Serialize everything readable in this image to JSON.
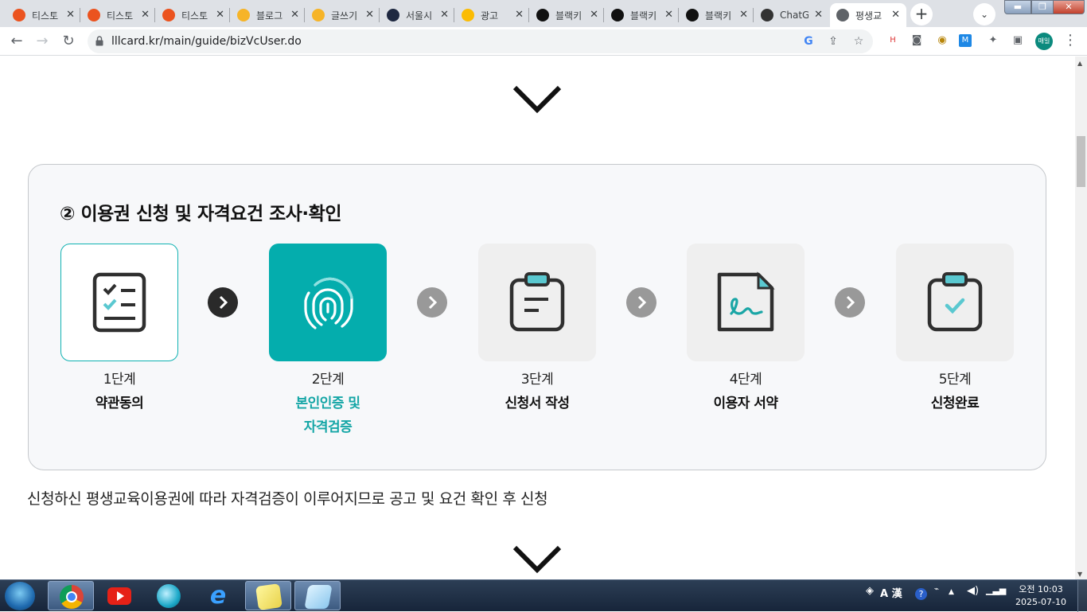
{
  "browser": {
    "tabs": [
      {
        "title": "티스토",
        "icon": "tistory-icon",
        "color": "#eb531f",
        "active": false
      },
      {
        "title": "티스토",
        "icon": "tistory-icon",
        "color": "#eb531f",
        "active": false
      },
      {
        "title": "티스토",
        "icon": "tistory-icon",
        "color": "#eb531f",
        "active": false
      },
      {
        "title": "블로그",
        "icon": "pm-icon",
        "color": "#f6b428",
        "active": false
      },
      {
        "title": "글쓰기",
        "icon": "pm-icon",
        "color": "#f6b428",
        "active": false
      },
      {
        "title": "서울시",
        "icon": "d-icon",
        "color": "#1e2840",
        "active": false
      },
      {
        "title": "광고",
        "icon": "google-ads-icon",
        "color": "#fbbc04",
        "active": false
      },
      {
        "title": "블랙키",
        "icon": "b-icon",
        "color": "#111111",
        "active": false
      },
      {
        "title": "블랙키",
        "icon": "b-icon",
        "color": "#111111",
        "active": false
      },
      {
        "title": "블랙키",
        "icon": "b-icon",
        "color": "#111111",
        "active": false
      },
      {
        "title": "ChatG",
        "icon": "openai-icon",
        "color": "#333333",
        "active": false
      },
      {
        "title": "평생교",
        "icon": "globe-icon",
        "color": "#5f6368",
        "active": true
      }
    ],
    "url": "lllcard.kr/main/guide/bizVcUser.do",
    "profile_label": "매일"
  },
  "page": {
    "section_title": "② 이용권 신청 및 자격요건 조사·확인",
    "steps": [
      {
        "num": "1단계",
        "label": "약관동의",
        "icon": "checklist-icon",
        "state": "done"
      },
      {
        "num": "2단계",
        "label_line1": "본인인증 및",
        "label_line2": "자격검증",
        "icon": "fingerprint-icon",
        "state": "current"
      },
      {
        "num": "3단계",
        "label": "신청서 작성",
        "icon": "clipboard-icon",
        "state": "todo"
      },
      {
        "num": "4단계",
        "label": "이용자 서약",
        "icon": "signature-document-icon",
        "state": "todo"
      },
      {
        "num": "5단계",
        "label": "신청완료",
        "icon": "clipboard-check-icon",
        "state": "todo"
      }
    ],
    "note": "신청하신 평생교육이용권에 따라 자격검증이 이루어지므로 공고 및 요건 확인 후 신청",
    "accent_color": "#04adad"
  },
  "taskbar": {
    "clock_time": "오전 10:03",
    "clock_date": "2025-07-10",
    "ime_label": "A 漢"
  }
}
